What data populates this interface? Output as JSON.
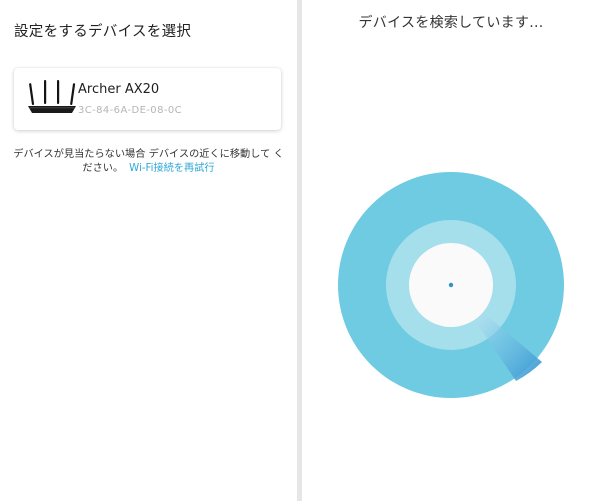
{
  "left": {
    "title": "設定をするデバイスを選択",
    "device": {
      "name": "Archer AX20",
      "mac": "3C-84-6A-DE-08-0C",
      "icon": "router-icon"
    },
    "help_text": "デバイスが見当たらない場合 デバイスの近くに移動して ください。",
    "retry_link": "Wi-Fi接続を再試行"
  },
  "right": {
    "title": "デバイスを検索しています...",
    "icon": "radar-scan-icon"
  },
  "colors": {
    "radar_outer": "#6fcbe1",
    "radar_ring": "#a6dfec",
    "radar_center": "#fafafa",
    "radar_sweep": "#2f91cf",
    "link": "#2fa8d8",
    "divider": "#e6e6e6"
  }
}
